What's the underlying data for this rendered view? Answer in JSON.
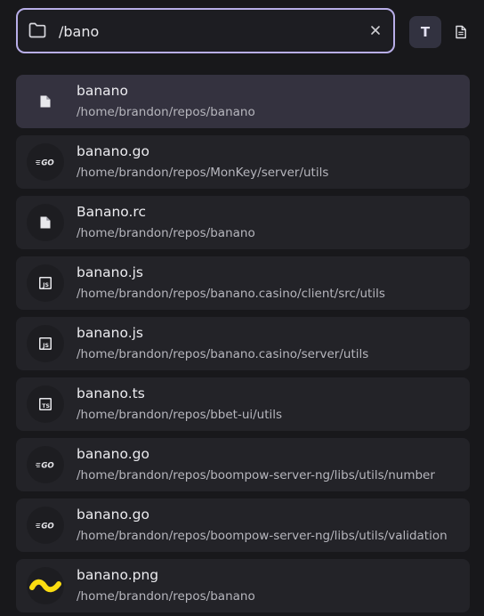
{
  "search": {
    "value": "/bano",
    "folder_icon": "folder-icon",
    "clear_icon": "close-icon"
  },
  "modes": {
    "text_label": "T",
    "file_icon": "document-icon"
  },
  "results": [
    {
      "name": "banano",
      "path": "/home/brandon/repos/banano",
      "icon": "file-icon",
      "selected": true
    },
    {
      "name": "banano.go",
      "path": "/home/brandon/repos/MonKey/server/utils",
      "icon": "go-icon",
      "icon_label": "GO"
    },
    {
      "name": "Banano.rc",
      "path": "/home/brandon/repos/banano",
      "icon": "file-icon"
    },
    {
      "name": "banano.js",
      "path": "/home/brandon/repos/banano.casino/client/src/utils",
      "icon": "js-icon",
      "icon_label": "JS"
    },
    {
      "name": "banano.js",
      "path": "/home/brandon/repos/banano.casino/server/utils",
      "icon": "js-icon",
      "icon_label": "JS"
    },
    {
      "name": "banano.ts",
      "path": "/home/brandon/repos/bbet-ui/utils",
      "icon": "ts-icon",
      "icon_label": "TS"
    },
    {
      "name": "banano.go",
      "path": "/home/brandon/repos/boompow-server-ng/libs/utils/number",
      "icon": "go-icon",
      "icon_label": "GO"
    },
    {
      "name": "banano.go",
      "path": "/home/brandon/repos/boompow-server-ng/libs/utils/validation",
      "icon": "go-icon",
      "icon_label": "GO"
    },
    {
      "name": "banano.png",
      "path": "/home/brandon/repos/banano",
      "icon": "banano-logo-icon"
    }
  ],
  "colors": {
    "accent": "#b8aee8",
    "background": "#18181b",
    "item_bg": "#232328",
    "selected_bg": "#34323f",
    "banano_yellow": "#fbdd11"
  }
}
